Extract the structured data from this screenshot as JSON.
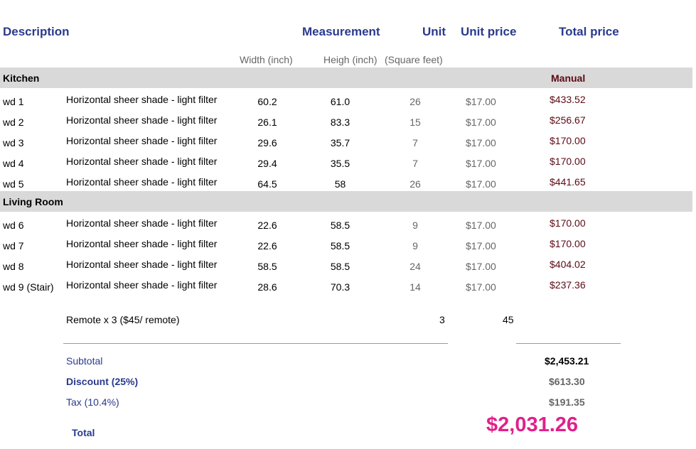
{
  "headers": {
    "description": "Description",
    "measurement": "Measurement",
    "unit": "Unit",
    "unit_price": "Unit price",
    "total_price": "Total price"
  },
  "subheaders": {
    "width": "Width (inch)",
    "height": "Heigh (inch)",
    "unit": "(Square feet)"
  },
  "sections": [
    {
      "name": "Kitchen",
      "note": "Manual",
      "rows": [
        {
          "id": "wd 1",
          "desc": "Horizontal sheer shade - light filter",
          "width": "60.2",
          "height": "61.0",
          "unit": "26",
          "unit_price": "$17.00",
          "total": "$433.52"
        },
        {
          "id": "wd 2",
          "desc": "Horizontal sheer shade - light filter",
          "width": "26.1",
          "height": "83.3",
          "unit": "15",
          "unit_price": "$17.00",
          "total": "$256.67"
        },
        {
          "id": "wd 3",
          "desc": "Horizontal sheer shade - light filter",
          "width": "29.6",
          "height": "35.7",
          "unit": "7",
          "unit_price": "$17.00",
          "total": "$170.00"
        },
        {
          "id": "wd 4",
          "desc": "Horizontal sheer shade - light filter",
          "width": "29.4",
          "height": "35.5",
          "unit": "7",
          "unit_price": "$17.00",
          "total": "$170.00"
        },
        {
          "id": "wd 5",
          "desc": "Horizontal sheer shade - light filter",
          "width": "64.5",
          "height": "58",
          "unit": "26",
          "unit_price": "$17.00",
          "total": "$441.65"
        }
      ]
    },
    {
      "name": "Living Room",
      "note": "",
      "rows": [
        {
          "id": "wd 6",
          "desc": "Horizontal sheer shade - light filter",
          "width": "22.6",
          "height": "58.5",
          "unit": "9",
          "unit_price": "$17.00",
          "total": "$170.00"
        },
        {
          "id": "wd 7",
          "desc": "Horizontal sheer shade - light filter",
          "width": "22.6",
          "height": "58.5",
          "unit": "9",
          "unit_price": "$17.00",
          "total": "$170.00"
        },
        {
          "id": "wd 8",
          "desc": "Horizontal sheer shade - light filter",
          "width": "58.5",
          "height": "58.5",
          "unit": "24",
          "unit_price": "$17.00",
          "total": "$404.02"
        },
        {
          "id": "wd 9 (Stair)",
          "desc": "Horizontal sheer shade - light filter",
          "width": "28.6",
          "height": "70.3",
          "unit": "14",
          "unit_price": "$17.00",
          "total": "$237.36"
        }
      ]
    }
  ],
  "remote": {
    "label": "Remote x 3 ($45/ remote)",
    "qty": "3",
    "price": "45"
  },
  "summary": {
    "subtotal_label": "Subtotal",
    "subtotal_value": "$2,453.21",
    "discount_label": "Discount (25%)",
    "discount_value": "$613.30",
    "tax_label": "Tax (10.4%)",
    "tax_value": "$191.35",
    "total_label": "Total",
    "total_value": "$2,031.26"
  },
  "colors": {
    "header_blue": "#2a3a8c",
    "total_magenta": "#e0218a",
    "price_maroon": "#5c0a14",
    "band_gray": "#d9d9d9"
  }
}
